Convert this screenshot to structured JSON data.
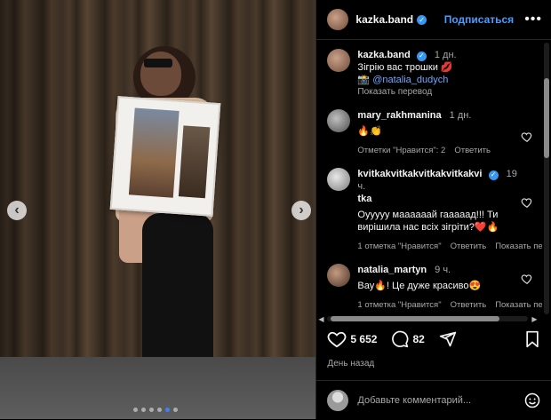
{
  "post": {
    "username": "kazka.band",
    "follow_label": "Подписаться",
    "more_label": "•••",
    "caption_time": "1 дн.",
    "caption_line1": "Зігрію вас трошки 💋",
    "caption_line2_prefix": "📸 ",
    "caption_mention": "@natalia_dudych",
    "translate_label": "Показать перевод",
    "likes": "5 652",
    "comments_count": "82",
    "date": "День назад",
    "add_comment_placeholder": "Добавьте комментарий..."
  },
  "comments": [
    {
      "username": "mary_rakhmanina",
      "time": "1 дн.",
      "text": "🔥👏",
      "likes_label": "Отметки \"Нравится\": 2",
      "reply_label": "Ответить"
    },
    {
      "username": "kvitkakvitkakvitkakvitkakvitka",
      "username_line1": "kvitkakvitkakvitkakvitkakvi",
      "username_line2": "tka",
      "time": "19 ч.",
      "text": "Оууууу маааааай гааааад!!! Ти вирішила нас всіх зігріти?❤️🔥",
      "likes_label": "1 отметка \"Нравится\"",
      "reply_label": "Ответить",
      "translate_label": "Показать пе"
    },
    {
      "username": "natalia_martyn",
      "time": "9 ч.",
      "text": "Вау🔥! Це дуже красиво😍",
      "likes_label": "1 отметка \"Нравится\"",
      "reply_label": "Ответить",
      "translate_label": "Показать пе"
    }
  ],
  "carousel": {
    "dots": 6,
    "active_index": 4
  },
  "colors": {
    "accent": "#4a9cff",
    "verified": "#3897f0",
    "background": "#000000"
  }
}
